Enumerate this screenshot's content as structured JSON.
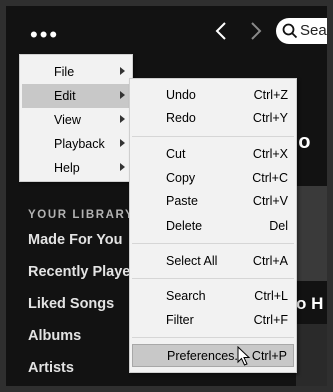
{
  "app": {
    "menu_dots": "•••",
    "search_text": "Sear",
    "section_title": "YOUR LIBRARY",
    "library": [
      "Made For You",
      "Recently Played",
      "Liked Songs",
      "Albums",
      "Artists"
    ],
    "bg_snippets": [
      "ho",
      "o H"
    ]
  },
  "main_menu": {
    "items": [
      {
        "label": "File"
      },
      {
        "label": "Edit"
      },
      {
        "label": "View"
      },
      {
        "label": "Playback"
      },
      {
        "label": "Help"
      }
    ]
  },
  "edit_menu": {
    "items": [
      {
        "label": "Undo",
        "shortcut": "Ctrl+Z"
      },
      {
        "label": "Redo",
        "shortcut": "Ctrl+Y"
      },
      {
        "label": "Cut",
        "shortcut": "Ctrl+X"
      },
      {
        "label": "Copy",
        "shortcut": "Ctrl+C"
      },
      {
        "label": "Paste",
        "shortcut": "Ctrl+V"
      },
      {
        "label": "Delete",
        "shortcut": "Del"
      },
      {
        "label": "Select All",
        "shortcut": "Ctrl+A"
      },
      {
        "label": "Search",
        "shortcut": "Ctrl+L"
      },
      {
        "label": "Filter",
        "shortcut": "Ctrl+F"
      },
      {
        "label": "Preferences...",
        "shortcut": "Ctrl+P"
      }
    ]
  }
}
